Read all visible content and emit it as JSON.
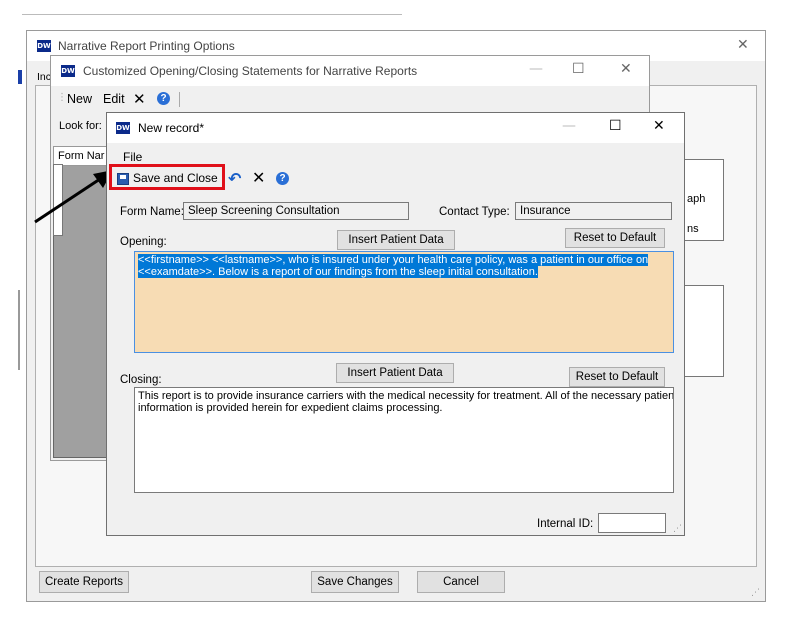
{
  "outer_window": {
    "title": "Narrative Report Printing Options",
    "close_glyph": "✕",
    "tab_fragment": "Inc",
    "right_text_1": "aph",
    "right_text_2": "ns",
    "footer": {
      "create_reports": "Create Reports",
      "save_changes": "Save Changes",
      "cancel": "Cancel"
    }
  },
  "list_window": {
    "title": "Customized Opening/Closing Statements for Narrative Reports",
    "minimize_glyph": "—",
    "maximize_glyph": "☐",
    "close_glyph": "✕",
    "toolbar": {
      "new": "New",
      "edit": "Edit",
      "delete_glyph": "✕"
    },
    "look_for_label": "Look for:",
    "column_fragment": "Form Nar"
  },
  "dialog": {
    "title": "New record*",
    "minimize_glyph": "—",
    "maximize_glyph": "☐",
    "close_glyph": "✕",
    "menu": {
      "file": "File"
    },
    "toolbar": {
      "save_and_close": "Save and Close",
      "undo_glyph": "↶",
      "delete_glyph": "✕"
    },
    "form_name_label": "Form Name:",
    "form_name_value": "Sleep Screening Consultation",
    "contact_type_label": "Contact Type:",
    "contact_type_value": "Insurance",
    "opening_label": "Opening:",
    "insert_patient_data": "Insert Patient Data",
    "reset_to_default": "Reset to Default",
    "opening_line1": "<<firstname>> <<lastname>>, who is insured under your health care policy, was a patient in our office on",
    "opening_line2": "<<examdate>>. Below is a report of our findings from the sleep initial consultation.",
    "closing_label": "Closing:",
    "closing_line1": "This report is to provide insurance carriers with the medical necessity for treatment. All of the necessary patient",
    "closing_line2": "information is provided herein for expedient claims processing.",
    "internal_id_label": "Internal ID:",
    "internal_id_value": ""
  },
  "colors": {
    "highlight_border": "#e0101a",
    "opening_background": "#f7dcb4",
    "selection": "#0078d7",
    "dw_logo": "#0b2a8a"
  }
}
